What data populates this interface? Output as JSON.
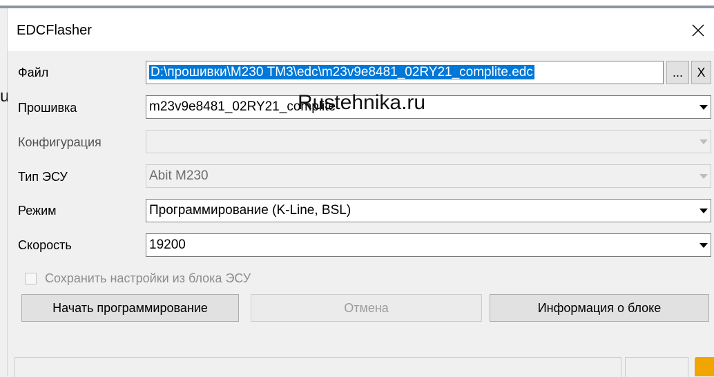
{
  "window": {
    "title": "EDCFlasher"
  },
  "watermark": "Rustehnika.ru",
  "left_fragment": "u",
  "fields": {
    "file": {
      "label": "Файл",
      "value": "D:\\прошивки\\M230 ТМ3\\edc\\m23v9e8481_02RY21_complite.edc",
      "browse_label": "...",
      "clear_label": "X"
    },
    "firmware": {
      "label": "Прошивка",
      "value": "m23v9e8481_02RY21_complite"
    },
    "configuration": {
      "label": "Конфигурация",
      "value": ""
    },
    "ecu_type": {
      "label": "Тип ЭСУ",
      "value": "Abit M230"
    },
    "mode": {
      "label": "Режим",
      "value": "Программирование (K-Line, BSL)"
    },
    "speed": {
      "label": "Скорость",
      "value": "19200"
    }
  },
  "checkbox": {
    "label": "Сохранить настройки из блока ЭСУ",
    "checked": false
  },
  "buttons": {
    "start": "Начать программирование",
    "cancel": "Отмена",
    "info": "Информация о блоке"
  },
  "colors": {
    "selection": "#0078d7",
    "accent": "#f0a500"
  }
}
